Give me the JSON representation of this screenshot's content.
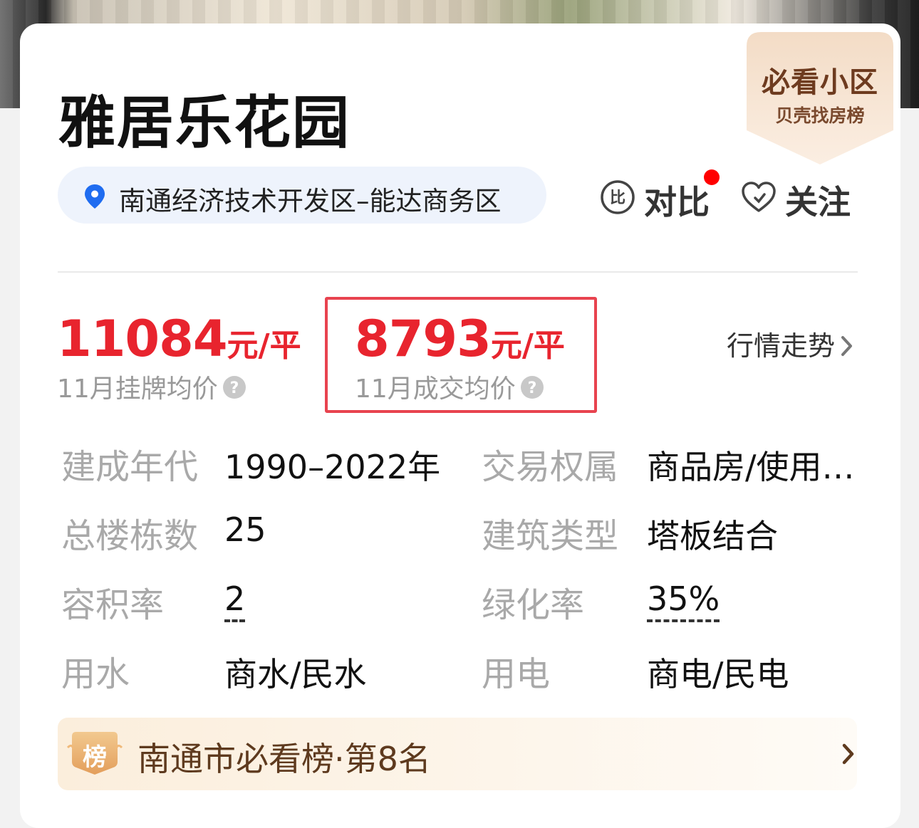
{
  "community": {
    "name": "雅居乐花园",
    "location": "南通经济技术开发区–能达商务区"
  },
  "badge": {
    "title": "必看小区",
    "subtitle": "贝壳找房榜"
  },
  "actions": {
    "compare_label": "对比",
    "compare_icon_glyph": "比",
    "follow_label": "关注"
  },
  "prices": {
    "listing": {
      "value": "11084",
      "unit": "元/平",
      "label": "11月挂牌均价"
    },
    "deal": {
      "value": "8793",
      "unit": "元/平",
      "label": "11月成交均价"
    },
    "trend_label": "行情走势"
  },
  "info": [
    {
      "label": "建成年代",
      "value": "1990–2022年"
    },
    {
      "label": "交易权属",
      "value": "商品房/使用…"
    },
    {
      "label": "总楼栋数",
      "value": "25"
    },
    {
      "label": "建筑类型",
      "value": "塔板结合"
    },
    {
      "label": "容积率",
      "value": "2"
    },
    {
      "label": "绿化率",
      "value": "35%"
    },
    {
      "label": "用水",
      "value": "商水/民水"
    },
    {
      "label": "用电",
      "value": "商电/民电"
    }
  ],
  "ranking": {
    "icon_text": "榜",
    "text": "南通市必看榜·第8名"
  },
  "colors": {
    "price_red": "#e8242e",
    "highlight_border": "#e8434f",
    "location_bg": "#eef3fc",
    "pin_blue": "#1f6cf0",
    "rank_text": "#5e3a1e"
  }
}
